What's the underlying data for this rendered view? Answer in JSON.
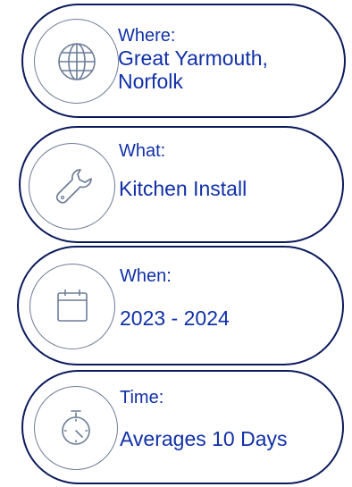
{
  "cards": [
    {
      "label": "Where:",
      "value_line1": "Great Yarmouth,",
      "value_line2": "Norfolk",
      "icon": "globe-icon"
    },
    {
      "label": "What:",
      "value_line1": "Kitchen Install",
      "icon": "wrench-icon"
    },
    {
      "label": "When:",
      "value_line1": "2023 - 2024",
      "icon": "calendar-icon"
    },
    {
      "label": "Time:",
      "value_line1": "Averages 10 Days",
      "icon": "stopwatch-icon"
    }
  ],
  "colors": {
    "border": "#0b1a5c",
    "text": "#1030a8",
    "icon": "#6d7d97"
  }
}
